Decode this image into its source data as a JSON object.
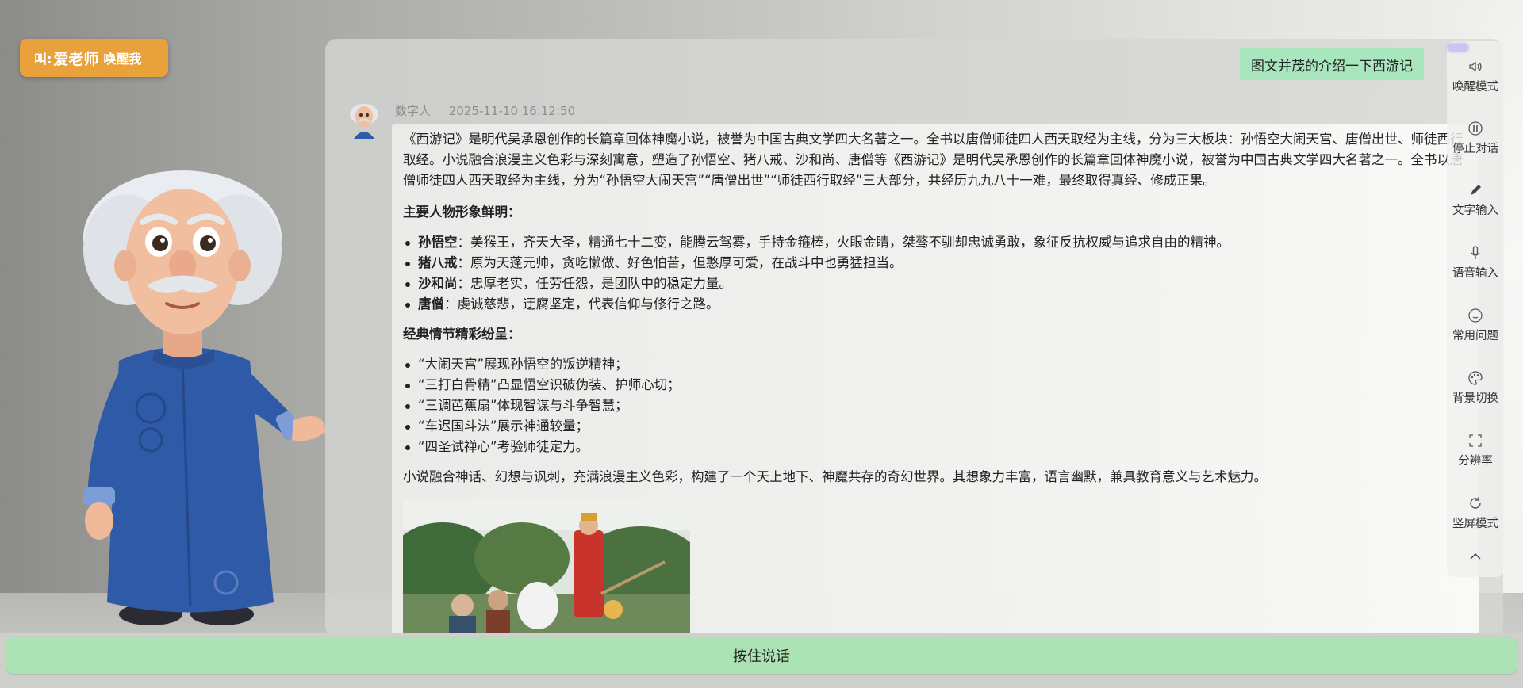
{
  "wake_badge": {
    "prefix": "叫:",
    "name": "爱老师",
    "suffix": "唤醒我"
  },
  "user_message": "图文并茂的介绍一下西游记",
  "bot": {
    "name": "数字人",
    "timestamp": "2025-11-10 16:12:50",
    "intro": "《西游记》是明代吴承恩创作的长篇章回体神魔小说，被誉为中国古典文学四大名著之一。全书以唐僧师徒四人西天取经为主线，分为三大板块：孙悟空大闹天宫、唐僧出世、师徒西行取经。小说融合浪漫主义色彩与深刻寓意，塑造了孙悟空、猪八戒、沙和尚、唐僧等《西游记》是明代吴承恩创作的长篇章回体神魔小说，被誉为中国古典文学四大名著之一。全书以唐僧师徒四人西天取经为主线，分为“孙悟空大闹天宫”“唐僧出世”“师徒西行取经”三大部分，共经历九九八十一难，最终取得真经、修成正果。",
    "characters_heading": "主要人物形象鲜明：",
    "characters": [
      {
        "name": "孙悟空",
        "desc": "：美猴王，齐天大圣，精通七十二变，能腾云驾雾，手持金箍棒，火眼金睛，桀骜不驯却忠诚勇敢，象征反抗权威与追求自由的精神。"
      },
      {
        "name": "猪八戒",
        "desc": "：原为天蓬元帅，贪吃懒做、好色怕苦，但憨厚可爱，在战斗中也勇猛担当。"
      },
      {
        "name": "沙和尚",
        "desc": "：忠厚老实，任劳任怨，是团队中的稳定力量。"
      },
      {
        "name": "唐僧",
        "desc": "：虔诚慈悲，迂腐坚定，代表信仰与修行之路。"
      }
    ],
    "plots_heading": "经典情节精彩纷呈：",
    "plots": [
      "“大闹天宫”展现孙悟空的叛逆精神；",
      "“三打白骨精”凸显悟空识破伪装、护师心切；",
      "“三调芭蕉扇”体现智谋与斗争智慧；",
      "“车迟国斗法”展示神通较量；",
      "“四圣试禅心”考验师徒定力。"
    ],
    "summary": "小说融合神话、幻想与讽刺，充满浪漫主义色彩，构建了一个天上地下、神魔共存的奇幻世界。其想象力丰富，语言幽默，兼具教育意义与艺术魅力。"
  },
  "toolbar": [
    {
      "label": "唤醒模式",
      "icon": "speaker-icon"
    },
    {
      "label": "停止对话",
      "icon": "pause-icon"
    },
    {
      "label": "文字输入",
      "icon": "pen-icon"
    },
    {
      "label": "语音输入",
      "icon": "microphone-icon"
    },
    {
      "label": "常用问题",
      "icon": "smile-icon"
    },
    {
      "label": "背景切换",
      "icon": "palette-icon"
    },
    {
      "label": "分辨率",
      "icon": "expand-icon"
    },
    {
      "label": "竖屏模式",
      "icon": "rotate-icon"
    }
  ],
  "push_to_talk": "按住说话",
  "colors": {
    "badge": "#e9a13b",
    "accent_green": "#a8e6bd",
    "ptt_green": "#abe3b4"
  }
}
